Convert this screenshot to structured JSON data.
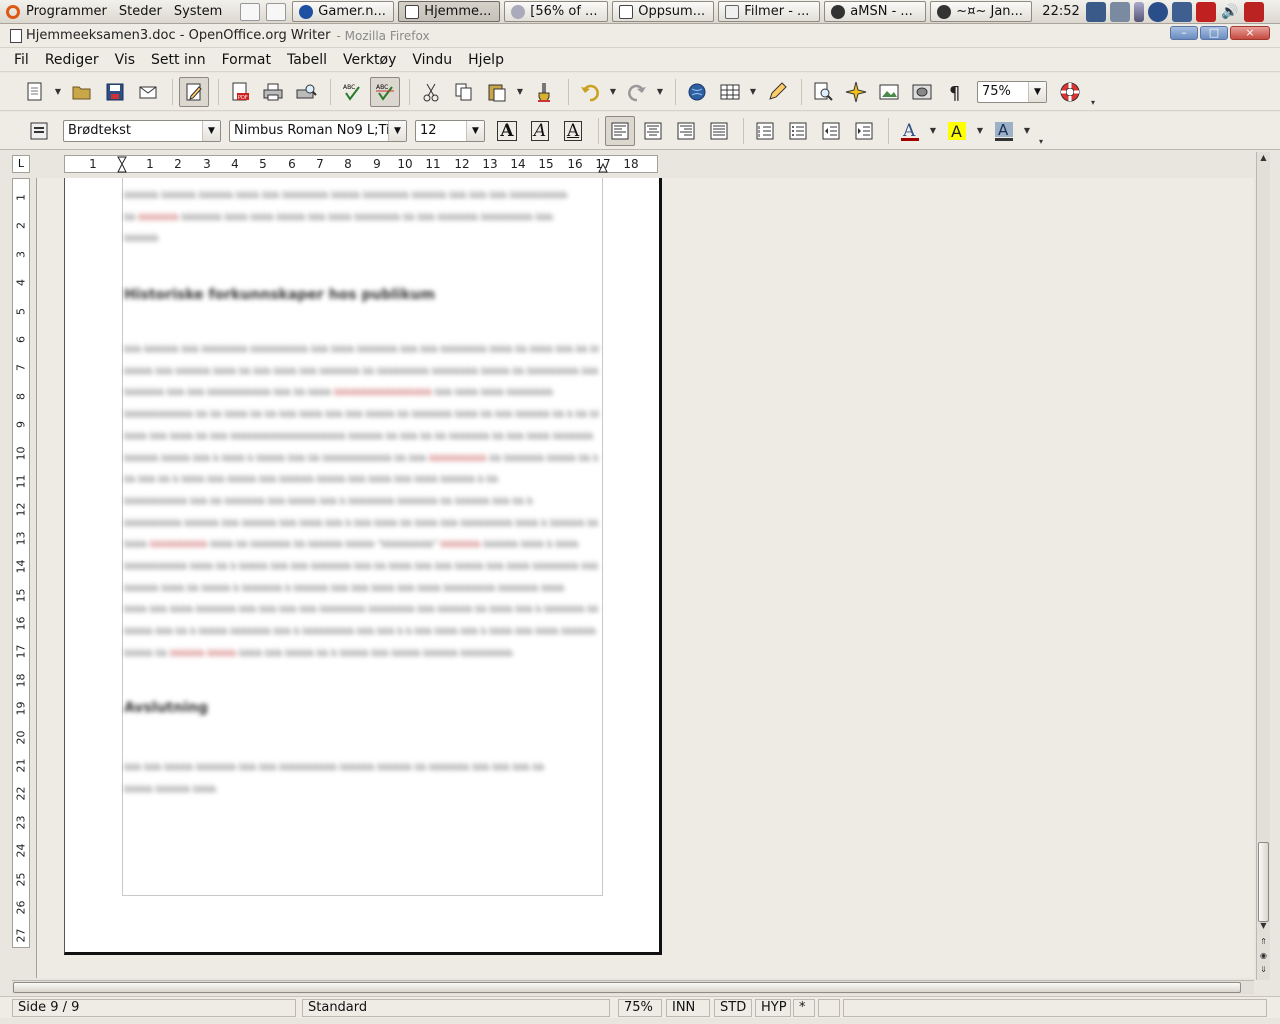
{
  "panel": {
    "menus": [
      "Programmer",
      "Steder",
      "System"
    ],
    "tasks": [
      {
        "label": "Gamer.n...",
        "active": false
      },
      {
        "label": "Hjemme...",
        "active": true
      },
      {
        "label": "[56% of ...",
        "active": false
      },
      {
        "label": "Oppsum...",
        "active": false
      },
      {
        "label": "Filmer - ...",
        "active": false
      },
      {
        "label": "aMSN - ...",
        "active": false
      },
      {
        "label": "~¤~ Jan...",
        "active": false
      }
    ],
    "clock": "22:52"
  },
  "window": {
    "title": "Hjemmeeksamen3.doc - OpenOffice.org Writer",
    "ghost_title": "- Mozilla Firefox",
    "min": "–",
    "max": "□",
    "close": "×"
  },
  "menubar": [
    "Fil",
    "Rediger",
    "Vis",
    "Sett inn",
    "Format",
    "Tabell",
    "Verktøy",
    "Vindu",
    "Hjelp"
  ],
  "toolbar": {
    "zoom": "75%",
    "paragraph_style": "Brødtekst",
    "font_name": "Nimbus Roman No9 L;Ti",
    "font_size": "12",
    "bold": "A",
    "italic": "A",
    "underline": "A"
  },
  "ruler": {
    "corner": "L",
    "h_ticks": [
      "1",
      "1",
      "2",
      "3",
      "4",
      "5",
      "6",
      "7",
      "8",
      "9",
      "10",
      "11",
      "12",
      "13",
      "14",
      "15",
      "16",
      "17",
      "18"
    ],
    "v_ticks": [
      "1",
      "2",
      "3",
      "4",
      "5",
      "6",
      "7",
      "8",
      "9",
      "10",
      "11",
      "12",
      "13",
      "14",
      "15",
      "16",
      "17",
      "18",
      "19",
      "20",
      "21",
      "22",
      "23",
      "24",
      "25",
      "26",
      "27"
    ]
  },
  "document": {
    "heading1": "Historiske forkunnskaper hos publikum",
    "heading2": "Avslutning"
  },
  "status": {
    "page": "Side 9 / 9",
    "style": "Standard",
    "zoom": "75%",
    "insert": "INN",
    "selection": "STD",
    "hyperlink": "HYP",
    "modified": "*"
  },
  "colors": {
    "accent": "#6a8cc0",
    "highlight": "#ffff00",
    "font_color": "#a00000"
  }
}
